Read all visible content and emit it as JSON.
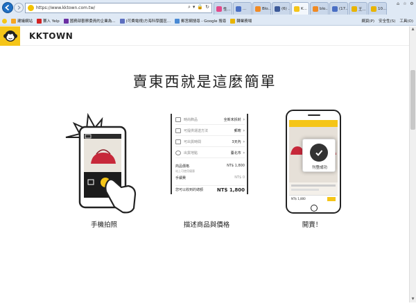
{
  "browser": {
    "url": "https://www.kktown.com.tw/",
    "tabs": [
      {
        "label": "性...",
        "color": "#e2498a",
        "active": false
      },
      {
        "label": "...",
        "color": "#4a6fc4",
        "active": false
      },
      {
        "label": "Blo...",
        "color": "#f08a24",
        "active": false
      },
      {
        "label": "(6) ...",
        "color": "#3b5998",
        "active": false
      },
      {
        "label": "K...",
        "color": "#f5c518",
        "active": true
      },
      {
        "label": "blo...",
        "color": "#f08a24",
        "active": false
      },
      {
        "label": "(17...",
        "color": "#4a6fc4",
        "active": false
      },
      {
        "label": "王...",
        "color": "#e8b400",
        "active": false
      },
      {
        "label": "10...",
        "color": "#e8b400",
        "active": false
      }
    ],
    "favorites": [
      {
        "label": "建議網站",
        "color": "#f5a623"
      },
      {
        "label": "賽入 Yelp",
        "color": "#d32323"
      },
      {
        "label": "國務部觀察委員的企業為...",
        "color": "#6b2fa3"
      },
      {
        "label": "(可費電視)方海科學園區...",
        "color": "#5d6fbf"
      },
      {
        "label": "郵宮網搜尋 - Google 搜尋",
        "color": "#4a8ad4"
      },
      {
        "label": "轉業務場",
        "color": "#e8b400"
      }
    ],
    "commands": [
      "網頁(P)",
      "安全性(S)",
      "工具(O)"
    ]
  },
  "site": {
    "brand": "KKTOWN"
  },
  "main": {
    "headline": "賣東西就是這麼簡單",
    "steps": [
      {
        "label": "手機拍照"
      },
      {
        "label": "描述商品與價格"
      },
      {
        "label": "開賣！"
      }
    ],
    "form": {
      "rows": [
        {
          "label": "時尚飾品",
          "value": "全新未拆封"
        },
        {
          "label": "可提供運送方法",
          "value": "郵寄"
        },
        {
          "label": "可出貨時間",
          "value": "3天內"
        },
        {
          "label": "出貨地點",
          "value": "臺北市"
        }
      ],
      "price_label": "商品價格",
      "price_value": "NT$ 1,800",
      "price_note": "站上可使用優惠",
      "fee_label": "手續費",
      "fee_value": "NT$ 0",
      "total_label": "您可以收到的總額",
      "total_value": "NT$ 1,800"
    },
    "listing": {
      "success": "刊登成功",
      "price": "NT$ 1,800"
    }
  }
}
